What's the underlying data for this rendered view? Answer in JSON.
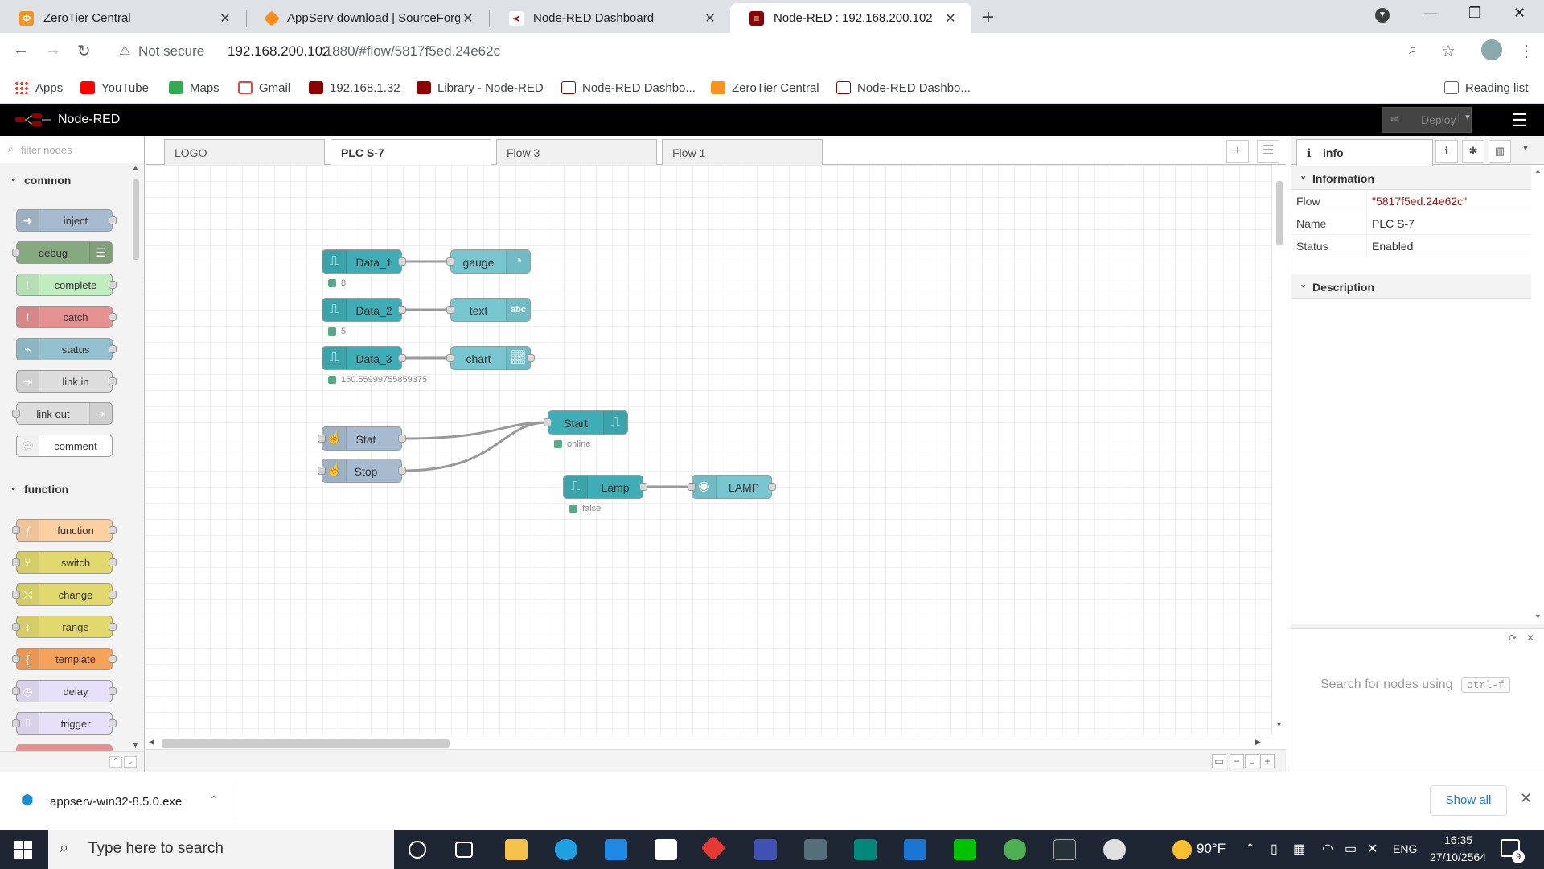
{
  "browser": {
    "tabs": [
      {
        "title": "ZeroTier Central"
      },
      {
        "title": "AppServ download | SourceForge.net"
      },
      {
        "title": "Node-RED Dashboard"
      },
      {
        "title": "Node-RED : 192.168.200.102"
      }
    ],
    "security_label": "Not secure",
    "url_host": "192.168.200.102",
    "url_path": ":1880/#flow/5817f5ed.24e62c",
    "bookmarks": [
      {
        "label": "Apps"
      },
      {
        "label": "YouTube"
      },
      {
        "label": "Maps"
      },
      {
        "label": "Gmail"
      },
      {
        "label": "192.168.1.32"
      },
      {
        "label": "Library - Node-RED"
      },
      {
        "label": "Node-RED Dashbo..."
      },
      {
        "label": "ZeroTier Central"
      },
      {
        "label": "Node-RED Dashbo..."
      }
    ],
    "reading_list": "Reading list"
  },
  "nodered": {
    "app_title": "Node-RED",
    "deploy_label": "Deploy",
    "palette": {
      "filter_placeholder": "filter nodes",
      "categories": [
        {
          "name": "common",
          "nodes": [
            "inject",
            "debug",
            "complete",
            "catch",
            "status",
            "link in",
            "link out",
            "comment"
          ]
        },
        {
          "name": "function",
          "nodes": [
            "function",
            "switch",
            "change",
            "range",
            "template",
            "delay",
            "trigger"
          ]
        }
      ]
    },
    "workspace_tabs": [
      "LOGO",
      "PLC S-7",
      "Flow 3",
      "Flow 1"
    ],
    "active_tab": "PLC S-7",
    "flow_nodes": {
      "data1": {
        "label": "Data_1",
        "status": "8"
      },
      "data2": {
        "label": "Data_2",
        "status": "5"
      },
      "data3": {
        "label": "Data_3",
        "status": "150.55999755859375"
      },
      "gauge": {
        "label": "gauge"
      },
      "text": {
        "label": "text"
      },
      "chart": {
        "label": "chart"
      },
      "stat": {
        "label": "Stat"
      },
      "stop": {
        "label": "Stop"
      },
      "start": {
        "label": "Start",
        "status": "online"
      },
      "lamp": {
        "label": "Lamp",
        "status": "false"
      },
      "lamp_out": {
        "label": "LAMP"
      }
    },
    "sidebar": {
      "tab_label": "info",
      "information_header": "Information",
      "rows": [
        {
          "key": "Flow",
          "value": "\"5817f5ed.24e62c\""
        },
        {
          "key": "Name",
          "value": "PLC S-7"
        },
        {
          "key": "Status",
          "value": "Enabled"
        }
      ],
      "description_header": "Description",
      "help_text": "Search for nodes using",
      "help_kbd": "ctrl-f"
    }
  },
  "download": {
    "filename": "appserv-win32-8.5.0.exe",
    "show_all": "Show all"
  },
  "taskbar": {
    "search_placeholder": "Type here to search",
    "weather": "90°F",
    "language": "ENG",
    "time": "16:35",
    "date": "27/10/2564",
    "notification_count": "9"
  },
  "colors": {
    "inject": "#a6bbcf",
    "debug": "#87a980",
    "complete": "#c0edc0",
    "catch": "#e49191",
    "status": "#94c1d0",
    "link": "#dddddd",
    "comment": "#ffffff",
    "function": "#fdd0a2",
    "switch": "#e2d96e",
    "delay": "#e6e0f8",
    "s7": "#3fadb5",
    "dashboard": "#77c6cf"
  }
}
